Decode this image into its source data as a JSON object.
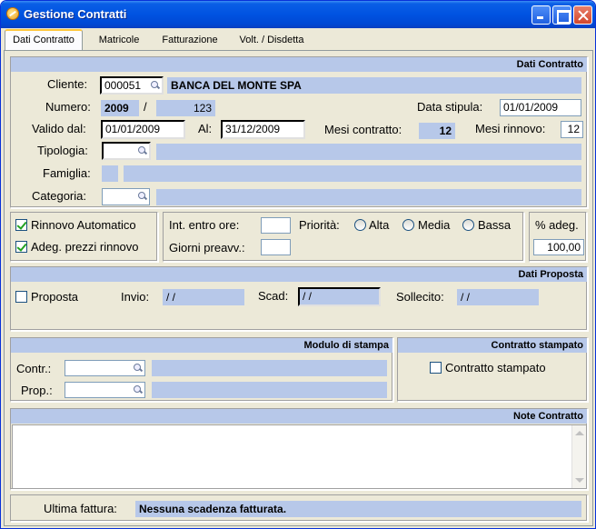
{
  "window": {
    "title": "Gestione Contratti"
  },
  "tabs": [
    "Dati Contratto",
    "Matricole",
    "Fatturazione",
    "Volt. / Disdetta"
  ],
  "dati_contratto": {
    "header": "Dati Contratto",
    "cliente_label": "Cliente:",
    "cliente_code": "000051",
    "cliente_name": "BANCA DEL MONTE SPA",
    "numero_label": "Numero:",
    "numero_year": "2009",
    "numero_sep": "/",
    "numero_value": "123",
    "data_stipula_label": "Data stipula:",
    "data_stipula": "01/01/2009",
    "valido_dal_label": "Valido dal:",
    "valido_dal": "01/01/2009",
    "al_label": "Al:",
    "al": "31/12/2009",
    "mesi_contratto_label": "Mesi contratto:",
    "mesi_contratto": "12",
    "mesi_rinnovo_label": "Mesi rinnovo:",
    "mesi_rinnovo": "12",
    "tipologia_label": "Tipologia:",
    "famiglia_label": "Famiglia:",
    "categoria_label": "Categoria:"
  },
  "rinnovo": {
    "rinnovo_automatico_label": "Rinnovo Automatico",
    "adeg_prezzi_label": "Adeg. prezzi rinnovo"
  },
  "intervento": {
    "int_entro_ore_label": "Int. entro ore:",
    "giorni_preavv_label": "Giorni preavv.:",
    "priorita_label": "Priorità:",
    "alta_label": "Alta",
    "media_label": "Media",
    "bassa_label": "Bassa"
  },
  "adeg": {
    "label": "% adeg.",
    "value": "100,00"
  },
  "dati_proposta": {
    "header": "Dati Proposta",
    "proposta_label": "Proposta",
    "invio_label": "Invio:",
    "invio": "  /    /",
    "scad_label": "Scad:",
    "scad": "  /    /",
    "sollecito_label": "Sollecito:",
    "sollecito": "  /    /"
  },
  "modulo_stampa": {
    "header": "Modulo di stampa",
    "contr_label": "Contr.:",
    "prop_label": "Prop.:"
  },
  "contratto_stampato": {
    "header": "Contratto stampato",
    "checkbox_label": "Contratto stampato"
  },
  "note": {
    "header": "Note Contratto"
  },
  "ultima_fattura": {
    "label": "Ultima fattura:",
    "value": "Nessuna scadenza fatturata."
  }
}
